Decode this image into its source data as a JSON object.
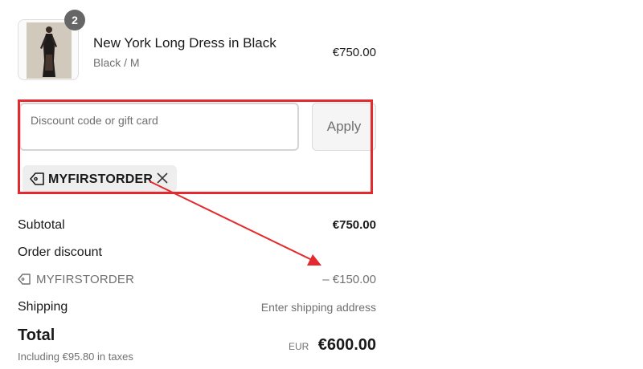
{
  "cart": {
    "item": {
      "quantity_badge": "2",
      "name": "New York Long Dress in Black",
      "variant": "Black / M",
      "price": "€750.00"
    }
  },
  "discount": {
    "placeholder": "Discount code or gift card",
    "apply_label": "Apply",
    "applied_code": "MYFIRSTORDER"
  },
  "summary": {
    "subtotal_label": "Subtotal",
    "subtotal_value": "€750.00",
    "order_discount_label": "Order discount",
    "discount_code": "MYFIRSTORDER",
    "discount_value": "– €150.00",
    "shipping_label": "Shipping",
    "shipping_value": "Enter shipping address",
    "total_label": "Total",
    "tax_note": "Including €95.80 in taxes",
    "currency": "EUR",
    "total_value": "€600.00"
  },
  "colors": {
    "annotation_red": "#e32b2f",
    "muted_text": "#707070",
    "badge_bg": "#666666"
  }
}
